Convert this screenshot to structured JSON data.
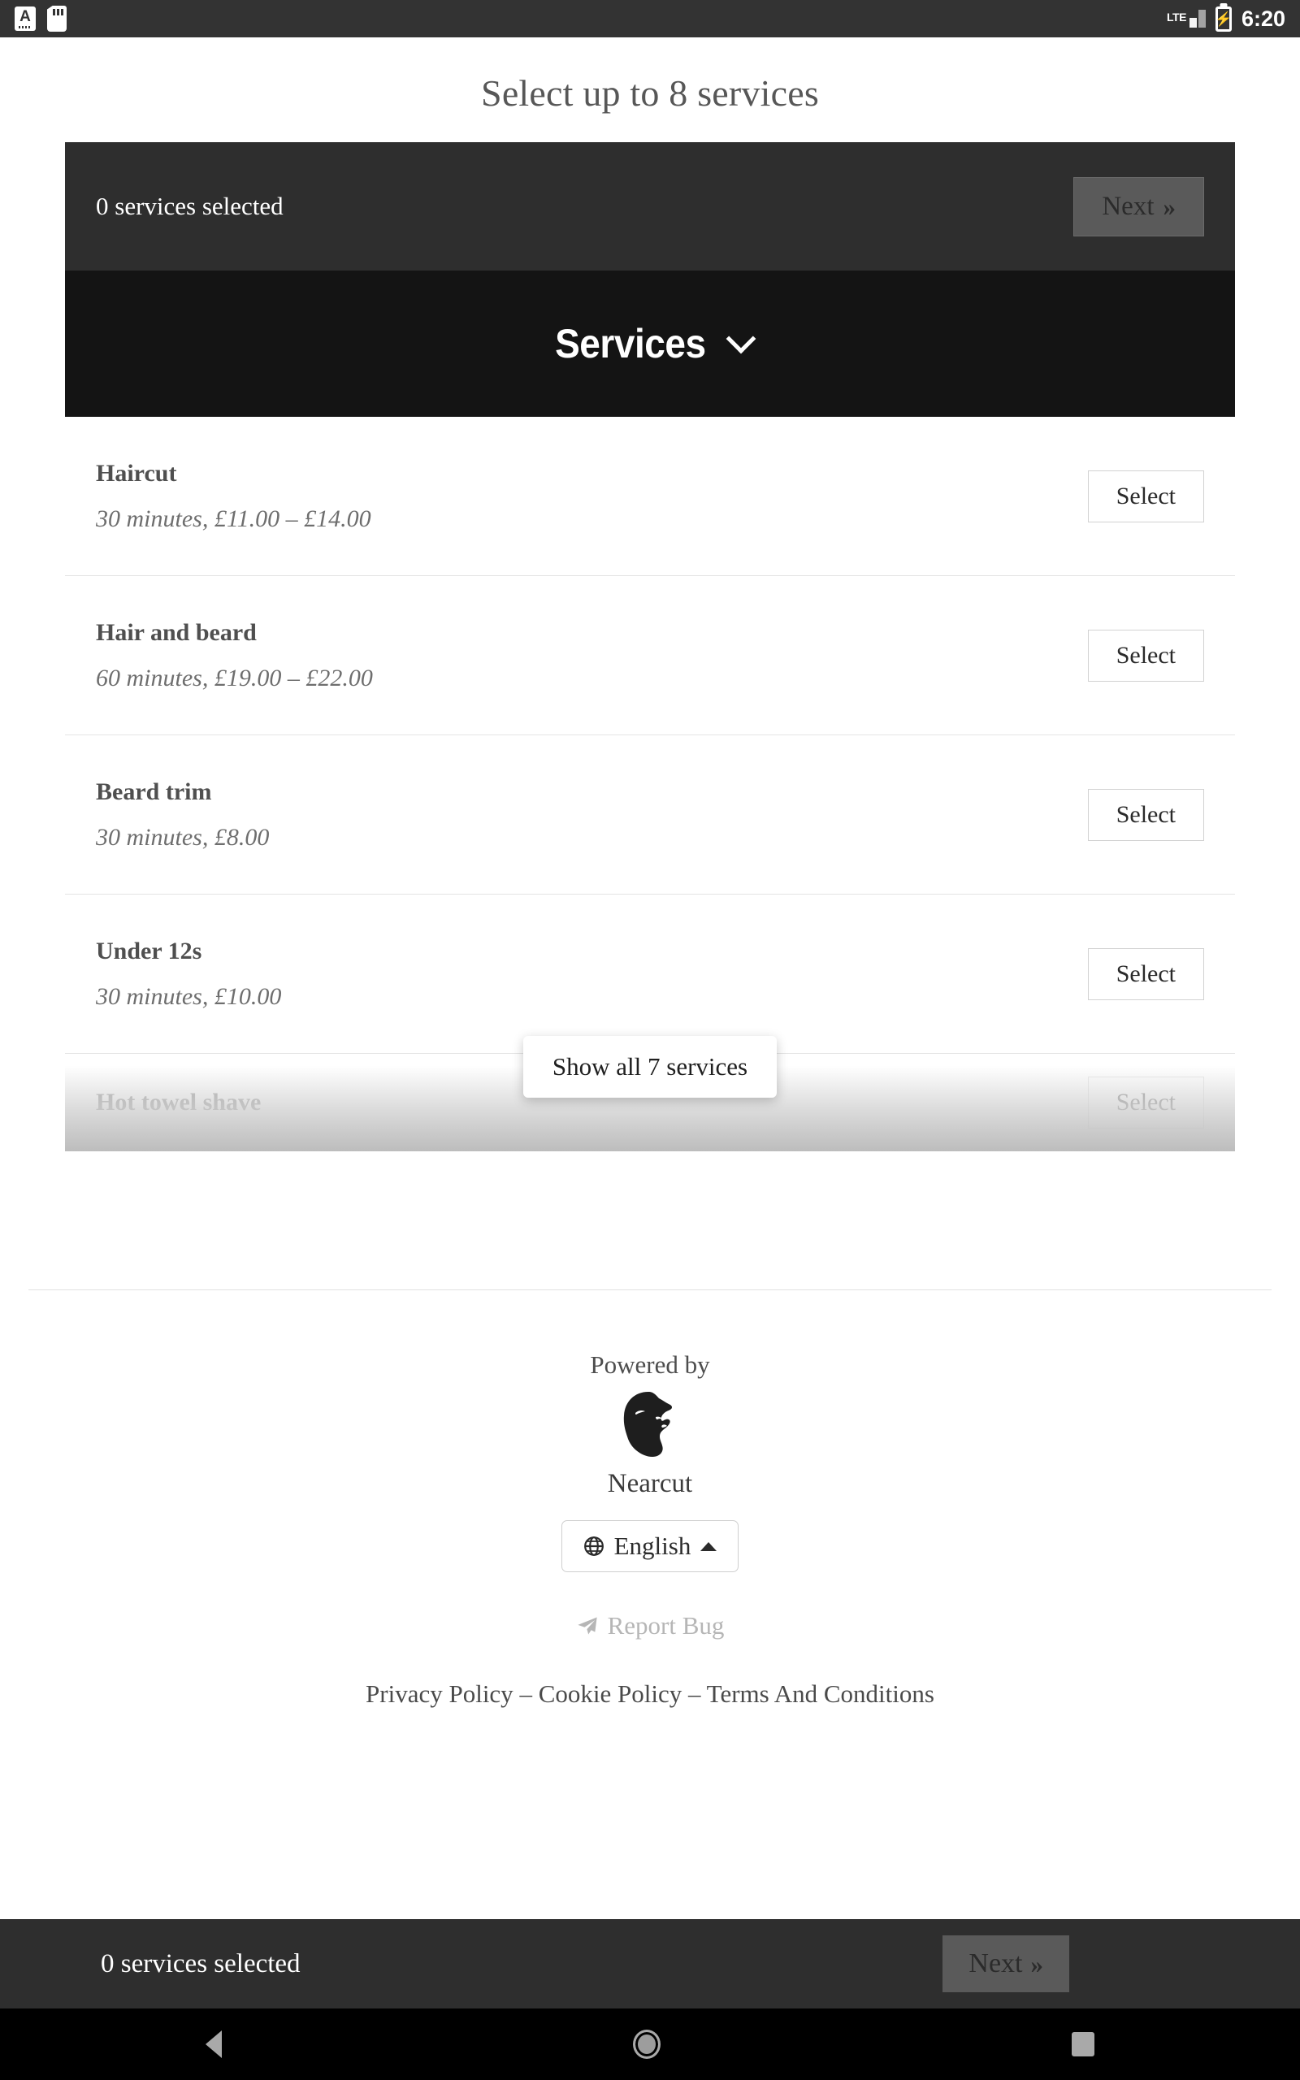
{
  "status_bar": {
    "left_icons": [
      "letter-a-badge-icon",
      "sd-card-icon"
    ],
    "network": "LTE",
    "battery_state": "charging",
    "time": "6:20"
  },
  "page": {
    "title": "Select up to 8 services"
  },
  "summary_bar": {
    "selected_text": "0 services selected",
    "next_label": "Next",
    "next_chevron": "»",
    "next_enabled": false,
    "background": "#2e2e2e",
    "button_background": "#5a5a5a"
  },
  "services_section": {
    "header_label": "Services",
    "header_icon": "chevron-down-icon",
    "header_background": "#141414",
    "items": [
      {
        "name": "Haircut",
        "meta": "30 minutes, £11.00 – £14.00",
        "action": "Select"
      },
      {
        "name": "Hair and beard",
        "meta": "60 minutes, £19.00 – £22.00",
        "action": "Select"
      },
      {
        "name": "Beard trim",
        "meta": "30 minutes, £8.00",
        "action": "Select"
      },
      {
        "name": "Under 12s",
        "meta": "30 minutes, £10.00",
        "action": "Select"
      }
    ],
    "truncated_item": {
      "name": "Hot towel shave",
      "action": "Select"
    },
    "show_all_label": "Show all 7 services"
  },
  "footer": {
    "powered_by": "Powered by",
    "brand": "Nearcut",
    "brand_logo_icon": "bearded-man-logo-icon",
    "language": {
      "icon": "globe-icon",
      "value": "English",
      "caret": "caret-up-icon"
    },
    "report_bug": {
      "icon": "paper-plane-icon",
      "label": "Report Bug"
    },
    "legal_links": [
      "Privacy Policy",
      "Cookie Policy",
      "Terms And Conditions"
    ],
    "legal_separator": "–"
  },
  "bottom_bar": {
    "selected_text": "0 services selected",
    "next_label": "Next",
    "next_chevron": "»",
    "next_enabled": false
  },
  "nav_bar": {
    "buttons": [
      "back-nav-button",
      "home-nav-button",
      "recent-apps-nav-button"
    ]
  }
}
